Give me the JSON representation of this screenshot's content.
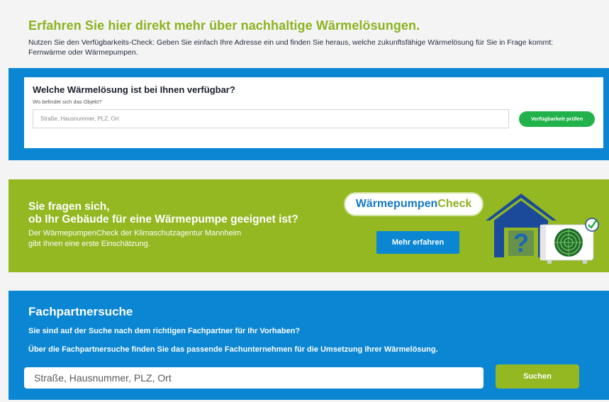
{
  "intro": {
    "heading": "Erfahren Sie hier direkt mehr über nachhaltige Wärmelösungen.",
    "text": "Nutzen Sie den Verfügbarkeits-Check: Geben Sie einfach Ihre Adresse ein und finden Sie heraus, welche zukunftsfähige Wärmelösung für Sie in Frage kommt: Fernwärme oder Wärmepumpen."
  },
  "availability": {
    "title": "Welche Wärmelösung ist bei Ihnen verfügbar?",
    "label": "Wo befindet sich das Objekt?",
    "placeholder": "Straße, Hausnummer, PLZ, Ort",
    "button": "Verfügbarkeit prüfen"
  },
  "heatpump": {
    "heading_line1": "Sie fragen sich,",
    "heading_line2": "ob Ihr Gebäude für eine Wärmepumpe geeignet ist?",
    "desc_line1": "Der WärmepumpenCheck der Klimaschutzagentur Mannheim",
    "desc_line2": "gibt Ihnen eine erste Einschätzung.",
    "badge_part1": "Wärmepumpen",
    "badge_part2": "Check",
    "button": "Mehr erfahren",
    "illustration_icon": "house-heatpump-icon"
  },
  "partner": {
    "title": "Fachpartnersuche",
    "line1": "Sie sind auf der Suche nach dem richtigen Fachpartner für Ihr Vorhaben?",
    "line2": "Über die Fachpartnersuche finden Sie das passende Fachunternehmen für die Umsetzung Ihrer Wärmelösung.",
    "placeholder": "Straße, Hausnummer, PLZ, Ort",
    "button": "Suchen"
  },
  "colors": {
    "green": "#93b822",
    "blue": "#0a86d3",
    "button_green": "#22b24c"
  }
}
